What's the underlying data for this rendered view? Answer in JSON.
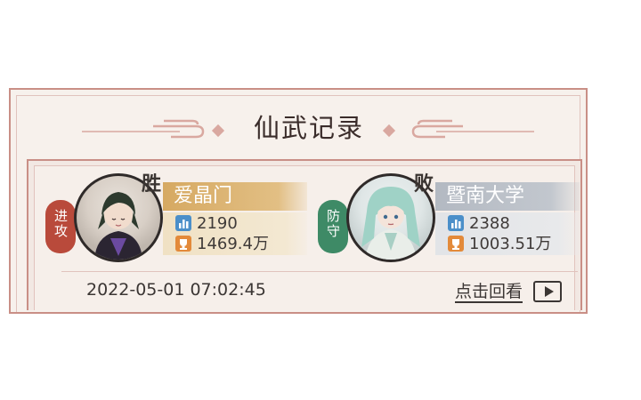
{
  "panel": {
    "title": "仙武记录"
  },
  "record": {
    "attacker": {
      "role_label": "进攻",
      "result": "胜",
      "name": "爱晶门",
      "power": "2190",
      "wealth": "1469.4万",
      "avatar": "avatar-dark-haired-male-purple-robe"
    },
    "defender": {
      "role_label": "防守",
      "result": "败",
      "name": "暨南大学",
      "power": "2388",
      "wealth": "1003.51万",
      "avatar": "avatar-teal-haired-character-white-robe"
    },
    "datetime": "2022-05-01 07:02:45",
    "replay_label": "点击回看"
  },
  "icons": {
    "power": "bar-chart-icon",
    "wealth": "trophy-icon",
    "replay": "play-icon"
  },
  "colors": {
    "panel_border": "#c98f86",
    "winner_bar": "#d9b06e",
    "loser_bar": "#b6bcc4",
    "attack_badge": "#b94a3b",
    "defense_badge": "#3e8a66",
    "icon_blue": "#4b8fc9",
    "icon_orange": "#e38a3a"
  }
}
